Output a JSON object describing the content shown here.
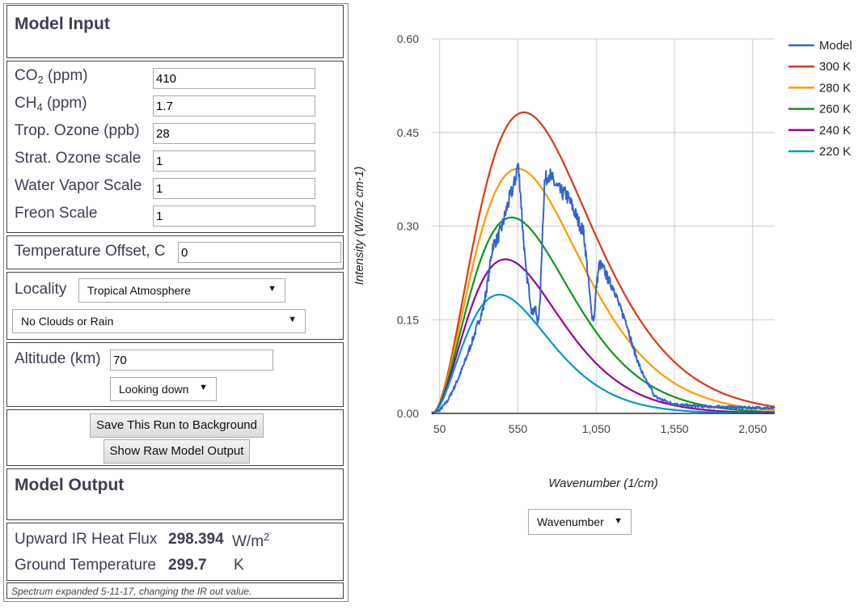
{
  "input": {
    "title": "Model Input",
    "fields": [
      {
        "label": "CO",
        "sub": "2",
        "suffix": " (ppm)",
        "value": "410"
      },
      {
        "label": "CH",
        "sub": "4",
        "suffix": " (ppm)",
        "value": "1.7"
      },
      {
        "label": "Trop. Ozone (ppb)",
        "sub": "",
        "suffix": "",
        "value": "28"
      },
      {
        "label": "Strat. Ozone scale",
        "sub": "",
        "suffix": "",
        "value": "1"
      },
      {
        "label": "Water Vapor Scale",
        "sub": "",
        "suffix": "",
        "value": "1"
      },
      {
        "label": "Freon Scale",
        "sub": "",
        "suffix": "",
        "value": "1"
      }
    ],
    "temp_offset": {
      "label": "Temperature Offset, C",
      "value": "0"
    },
    "locality": {
      "label": "Locality",
      "selected": "Tropical Atmosphere"
    },
    "clouds": {
      "selected": "No Clouds or Rain"
    },
    "altitude": {
      "label": "Altitude (km)",
      "value": "70"
    },
    "direction": {
      "selected": "Looking down"
    },
    "buttons": {
      "save": "Save This Run to Background",
      "raw": "Show Raw Model Output"
    },
    "dropdown_arrow": "▼"
  },
  "output": {
    "title": "Model Output",
    "flux": {
      "label": "Upward IR Heat Flux",
      "value": "298.394",
      "unit": "W/m",
      "unit_sup": "2"
    },
    "ground": {
      "label": "Ground Temperature",
      "value": "299.7",
      "unit": "K"
    },
    "note": "Spectrum expanded 5-11-17, changing the IR out value."
  },
  "xaxis_select": {
    "selected": "Wavenumber"
  },
  "chart_data": {
    "type": "line",
    "title": "",
    "xlabel": "Wavenumber (1/cm)",
    "ylabel": "Intensity (W/m2 cm-1)",
    "xlim": [
      0,
      2190
    ],
    "ylim": [
      0,
      0.6
    ],
    "xticks": [
      50,
      550,
      1050,
      1550,
      2050
    ],
    "xtick_labels": [
      "50",
      "550",
      "1,050",
      "1,550",
      "2,050"
    ],
    "yticks": [
      0,
      0.15,
      0.3,
      0.45,
      0.6
    ],
    "ytick_labels": [
      "0.00",
      "0.15",
      "0.30",
      "0.45",
      "0.60"
    ],
    "grid": true,
    "legend": "right",
    "series": [
      {
        "name": "Model",
        "color": "#3366cc",
        "kind": "model",
        "x": [
          0,
          50,
          100,
          150,
          200,
          250,
          290,
          330,
          360,
          390,
          420,
          450,
          480,
          510,
          530,
          550,
          565,
          580,
          600,
          620,
          640,
          660,
          675,
          690,
          705,
          720,
          745,
          780,
          820,
          860,
          900,
          940,
          970,
          990,
          1005,
          1020,
          1035,
          1050,
          1070,
          1100,
          1135,
          1165,
          1200,
          1245,
          1280,
          1320,
          1360,
          1400,
          1425,
          1470,
          1520,
          1580,
          1650,
          1750,
          1890,
          2000,
          2100,
          2190
        ],
        "y": [
          0,
          0.005,
          0.02,
          0.045,
          0.075,
          0.11,
          0.14,
          0.17,
          0.215,
          0.27,
          0.28,
          0.3,
          0.33,
          0.355,
          0.37,
          0.4,
          0.36,
          0.3,
          0.23,
          0.2,
          0.16,
          0.17,
          0.145,
          0.17,
          0.28,
          0.37,
          0.385,
          0.37,
          0.355,
          0.35,
          0.33,
          0.305,
          0.29,
          0.24,
          0.2,
          0.16,
          0.15,
          0.2,
          0.24,
          0.23,
          0.21,
          0.2,
          0.17,
          0.145,
          0.11,
          0.08,
          0.055,
          0.04,
          0.027,
          0.022,
          0.017,
          0.014,
          0.012,
          0.011,
          0.01,
          0.009,
          0.009,
          0.008
        ]
      },
      {
        "name": "300 K",
        "color": "#dc3912",
        "kind": "planck",
        "T": 300
      },
      {
        "name": "280 K",
        "color": "#ff9900",
        "kind": "planck",
        "T": 280
      },
      {
        "name": "260 K",
        "color": "#109618",
        "kind": "planck",
        "T": 260
      },
      {
        "name": "240 K",
        "color": "#990099",
        "kind": "planck",
        "T": 240
      },
      {
        "name": "220 K",
        "color": "#0099c6",
        "kind": "planck",
        "T": 220
      }
    ]
  }
}
